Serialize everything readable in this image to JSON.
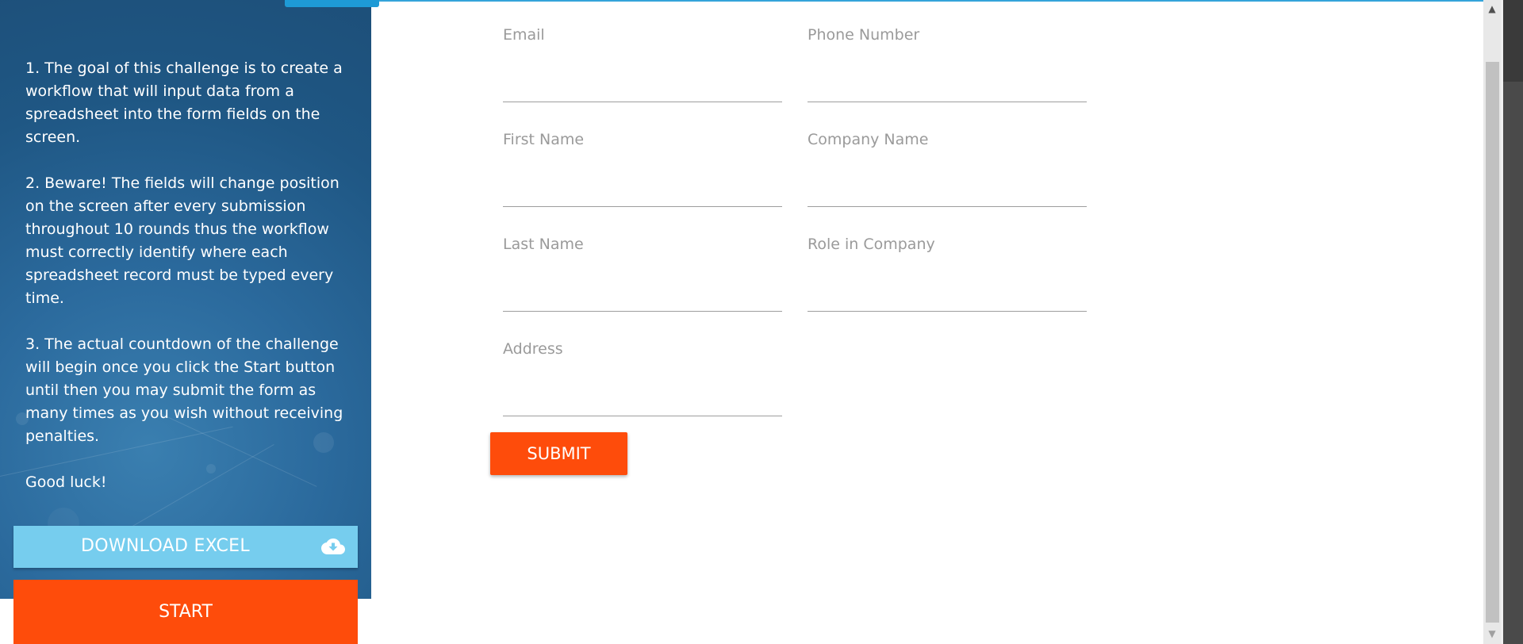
{
  "sidebar": {
    "instructions": [
      "1. The goal of this challenge is to create a workflow that will input data from a spreadsheet into the form fields on the screen.",
      "2. Beware! The fields will change position on the screen after every submission throughout 10 rounds thus the workflow must correctly identify where each spreadsheet record must be typed every time.",
      "3. The actual countdown of the challenge will begin once you click the Start button until then you may submit the form as many times as you wish without receiving penalties.",
      "Good luck!"
    ],
    "download_label": "DOWNLOAD EXCEL",
    "download_icon": "cloud-download-icon",
    "start_label": "START"
  },
  "form": {
    "fields": [
      {
        "label": "Email",
        "value": ""
      },
      {
        "label": "Phone Number",
        "value": ""
      },
      {
        "label": "First Name",
        "value": ""
      },
      {
        "label": "Company Name",
        "value": ""
      },
      {
        "label": "Last Name",
        "value": ""
      },
      {
        "label": "Role in Company",
        "value": ""
      },
      {
        "label": "Address",
        "value": ""
      }
    ],
    "submit_label": "SUBMIT"
  },
  "colors": {
    "sidebar_bg": "#1f5784",
    "accent_orange": "#fe4c0b",
    "download_blue": "#76cdee",
    "top_rule_blue": "#1e9ad6"
  }
}
